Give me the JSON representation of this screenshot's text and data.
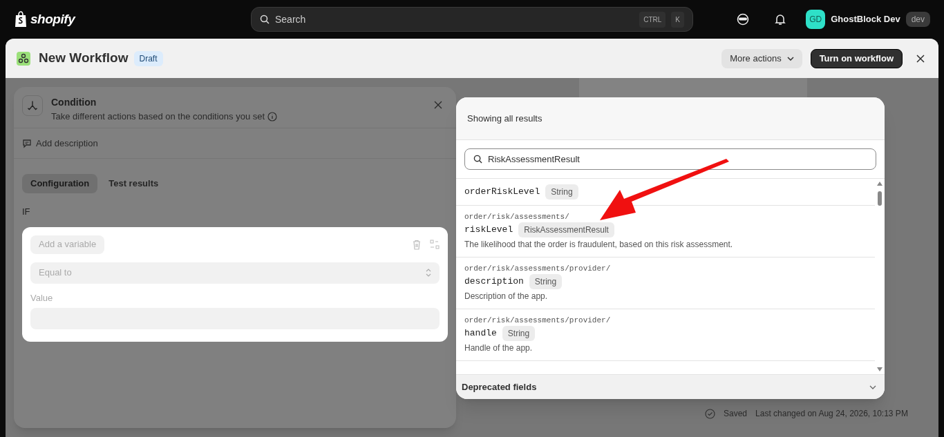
{
  "topbar": {
    "logo": "shopify",
    "search": {
      "placeholder": "Search",
      "shortcut": [
        "CTRL",
        "K"
      ]
    },
    "user": {
      "initials": "GD",
      "name": "GhostBlock Dev",
      "badge": "dev"
    }
  },
  "workflow": {
    "title": "New Workflow",
    "status": "Draft",
    "more_actions": "More actions",
    "primary_action": "Turn on workflow"
  },
  "condition_panel": {
    "title": "Condition",
    "subtitle": "Take different actions based on the conditions you set",
    "add_description": "Add description",
    "tabs": [
      {
        "label": "Configuration",
        "selected": true
      },
      {
        "label": "Test results",
        "selected": false
      }
    ],
    "if_label": "IF",
    "variable_button": "Add a variable",
    "operator": "Equal to",
    "value_label": "Value"
  },
  "picker": {
    "header": "Showing all results",
    "search": {
      "value": "RiskAssessmentResult"
    },
    "results": [
      {
        "name": "orderRiskLevel",
        "type": "String"
      },
      {
        "path": "order/risk/assessments/",
        "name": "riskLevel",
        "type": "RiskAssessmentResult",
        "description": "The likelihood that the order is fraudulent, based on this risk assessment."
      },
      {
        "path": "order/risk/assessments/provider/",
        "name": "description",
        "type": "String",
        "description": "Description of the app."
      },
      {
        "path": "order/risk/assessments/provider/",
        "name": "handle",
        "type": "String",
        "description": "Handle of the app."
      }
    ],
    "footer": "Deprecated fields"
  },
  "status_bar": {
    "saved": "Saved",
    "last_changed": "Last changed on Aug 24, 2026, 10:13 PM"
  }
}
